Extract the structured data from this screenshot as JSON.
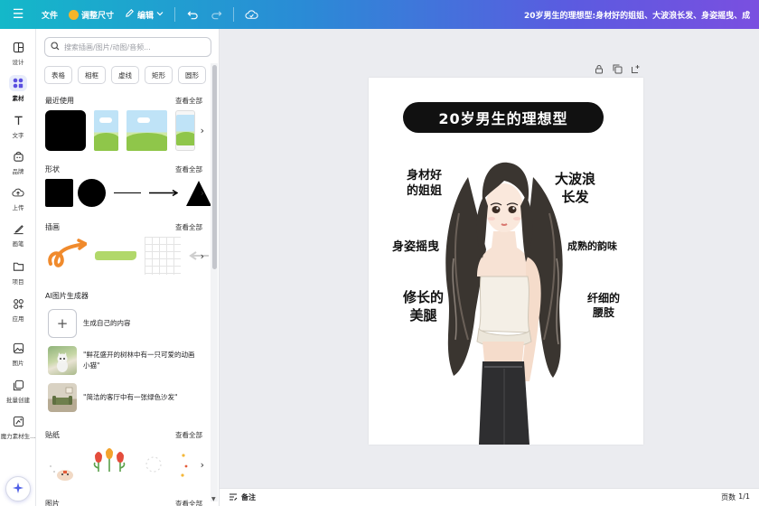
{
  "topbar": {
    "file_label": "文件",
    "resize_label": "调整尺寸",
    "edit_label": "编辑",
    "document_title": "20岁男生的理想型:身材好的姐姐、大波浪长发、身姿摇曳、成熟..."
  },
  "rail": {
    "items": [
      {
        "label": "设计",
        "icon": "layout-icon"
      },
      {
        "label": "素材",
        "icon": "elements-icon"
      },
      {
        "label": "文字",
        "icon": "text-icon"
      },
      {
        "label": "品牌",
        "icon": "brand-icon"
      },
      {
        "label": "上传",
        "icon": "upload-icon"
      },
      {
        "label": "画笔",
        "icon": "brush-icon"
      },
      {
        "label": "项目",
        "icon": "folder-icon"
      },
      {
        "label": "应用",
        "icon": "apps-icon"
      },
      {
        "label": "图片",
        "icon": "image-icon"
      },
      {
        "label": "批量创建",
        "icon": "bulk-create-icon"
      },
      {
        "label": "魔力素材生...",
        "icon": "magic-media-icon"
      }
    ]
  },
  "panel": {
    "search_placeholder": "搜索插画/图片/动图/音频...",
    "chips": [
      "表格",
      "相框",
      "虚线",
      "矩形",
      "圆形"
    ],
    "see_all": "查看全部",
    "recent_title": "最近使用",
    "shapes_title": "形状",
    "illustrations_title": "插画",
    "ai_title": "AI图片生成器",
    "ai_items": [
      {
        "text": "生成自己的内容"
      },
      {
        "text": "\"鲜花盛开的树林中有一只可爱的动画小猫\""
      },
      {
        "text": "\"简洁的客厅中有一张绿色沙发\""
      }
    ],
    "stickers_title": "贴纸",
    "photos_title": "图片"
  },
  "design": {
    "title": "20岁男生的理想型",
    "labels": {
      "body": [
        "身材好",
        "的姐姐"
      ],
      "hair": [
        "大波浪",
        "长发"
      ],
      "posture": "身姿摇曳",
      "charm": "成熟的韵味",
      "legs": [
        "修长的",
        "美腿"
      ],
      "waist": [
        "纤细的",
        "腰肢"
      ]
    }
  },
  "bottombar": {
    "notes_label": "备注",
    "pages_label": "页数",
    "pages_value": "1/1"
  },
  "colors": {
    "topbar_start": "#14b8c9",
    "topbar_end": "#7a4fe0",
    "title_bg": "#111111",
    "illustration_orange": "#f08a2c",
    "illustration_green": "#a8d45a"
  }
}
